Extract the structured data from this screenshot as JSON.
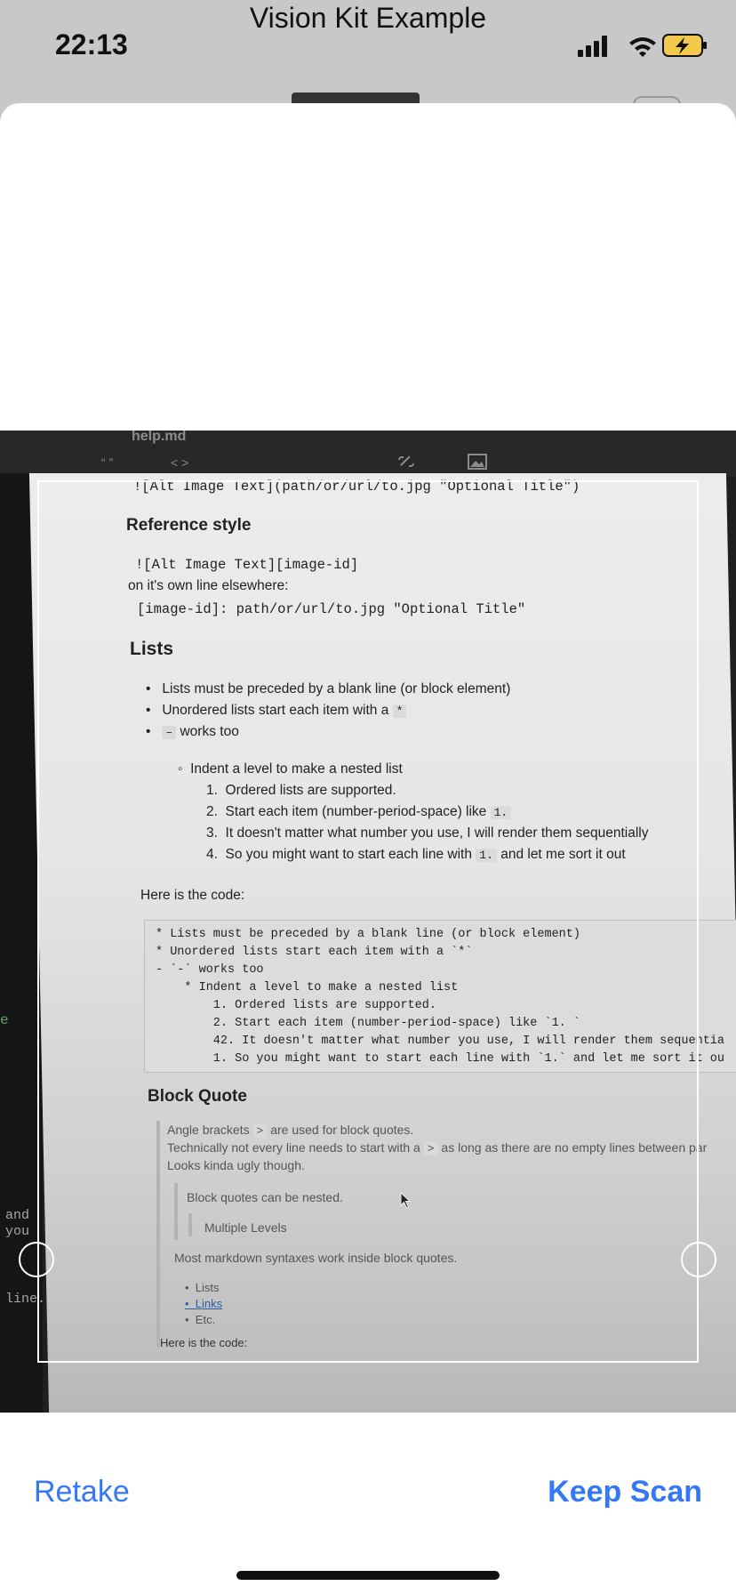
{
  "app": {
    "title": "Vision Kit Example"
  },
  "status_bar": {
    "time": "22:13",
    "icons": [
      "signal-icon",
      "wifi-icon",
      "battery-charging-icon"
    ]
  },
  "photo": {
    "tab_name": "help.md",
    "toolbar": {
      "quote": "“ ”",
      "code": "< >",
      "link_icon": "link-icon",
      "image_icon": "image-icon"
    },
    "left_edge": {
      "green": "e",
      "and": "and",
      "you": "you",
      "line": "line."
    },
    "doc": {
      "img_inline": "![Alt Image Text](path/or/url/to.jpg \"Optional Title\")",
      "reference_heading": "Reference style",
      "ref_line1": "![Alt Image Text][image-id]",
      "ref_line2": "on it's own line elsewhere:",
      "ref_line3": "[image-id]: path/or/url/to.jpg \"Optional Title\"",
      "lists_heading": "Lists",
      "bullet1": "Lists must be preceded by a blank line (or block element)",
      "bullet2": "Unordered lists start each item with a",
      "bullet2_chip": "*",
      "bullet3_chip": "–",
      "bullet3": "works too",
      "nested": "Indent a level to make a nested list",
      "ol1": "Ordered lists are supported.",
      "ol2": "Start each item (number-period-space) like",
      "ol2_chip": "1.",
      "ol3": "It doesn't matter what number you use, I will render them sequentially",
      "ol4a": "So you might want to start each line with",
      "ol4_chip": "1.",
      "ol4b": "and let me sort it out",
      "here_code": "Here is the code:",
      "code_lines": [
        "* Lists must be preceded by a blank line (or block element)",
        "* Unordered lists start each item with a `*`",
        "- `-` works too",
        "    * Indent a level to make a nested list",
        "        1. Ordered lists are supported.",
        "        2. Start each item (number-period-space) like `1. `",
        "        42. It doesn't matter what number you use, I will render them sequentia",
        "        1. So you might want to start each line with `1.` and let me sort it ou"
      ],
      "blockquote_heading": "Block Quote",
      "bq1a": "Angle brackets",
      "bq1_chip": ">",
      "bq1b": "are used for block quotes.",
      "bq2a": "Technically not every line needs to start with a",
      "bq2_chip": ">",
      "bq2b": "as long as there are no empty lines between par",
      "bq3": "Looks kinda ugly though.",
      "bq_nested": "Block quotes can be nested.",
      "bq_multi": "Multiple Levels",
      "bq_most": "Most markdown syntaxes work inside block quotes.",
      "bq_list": [
        "Lists",
        "Links",
        "Etc."
      ],
      "here_code2": "Here is the code:"
    }
  },
  "buttons": {
    "retake": "Retake",
    "keep": "Keep Scan"
  },
  "colors": {
    "accent": "#3478f6",
    "sheet": "#ffffff"
  }
}
